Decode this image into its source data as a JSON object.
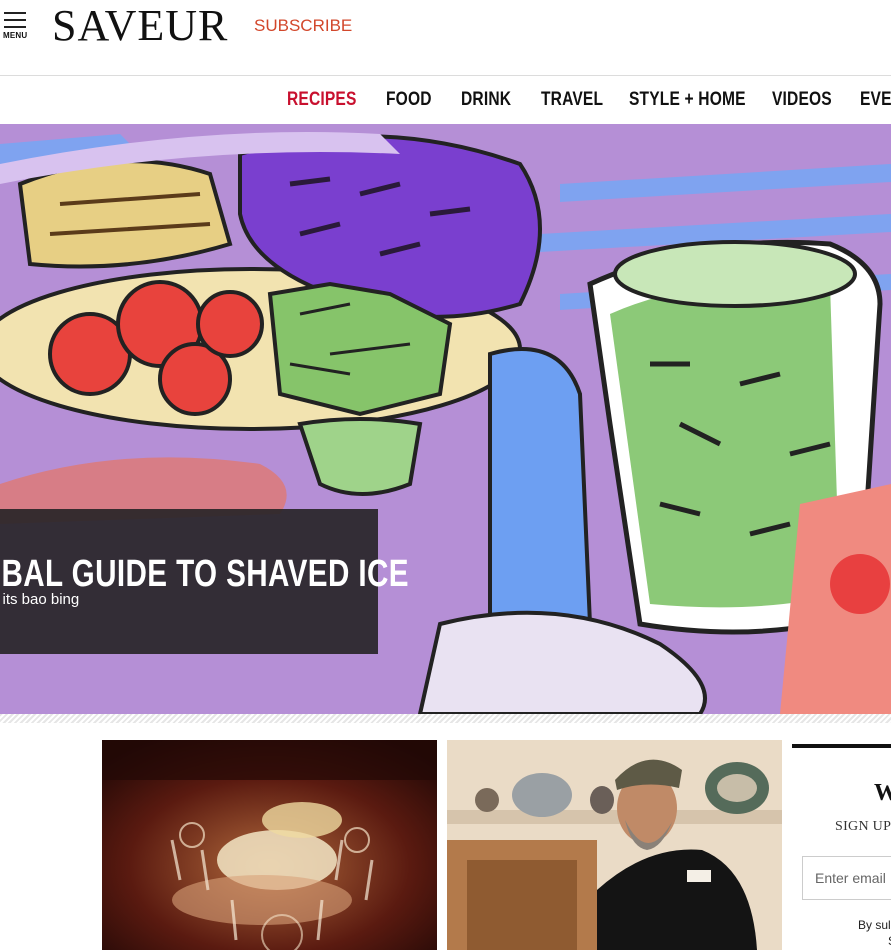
{
  "header": {
    "menu_label": "MENU",
    "logo": "SAVEUR",
    "subscribe": "SUBSCRIBE"
  },
  "nav": {
    "items": [
      {
        "label": "RECIPES",
        "active": true
      },
      {
        "label": "FOOD",
        "active": false
      },
      {
        "label": "DRINK",
        "active": false
      },
      {
        "label": "TRAVEL",
        "active": false
      },
      {
        "label": "STYLE + HOME",
        "active": false
      },
      {
        "label": "VIDEOS",
        "active": false
      },
      {
        "label": "EVE",
        "active": false
      }
    ]
  },
  "hero": {
    "title": "OBAL GUIDE TO SHAVED ICE",
    "subtitle": "n its bao bing"
  },
  "newsletter": {
    "heading": "W",
    "signup": "SIGN UP",
    "email_placeholder": "Enter email",
    "legal": "By sul",
    "legal_line2": "S"
  },
  "colors": {
    "accent_red": "#c8102e",
    "subscribe_red": "#d2472b",
    "caption_bg": "#282528"
  }
}
